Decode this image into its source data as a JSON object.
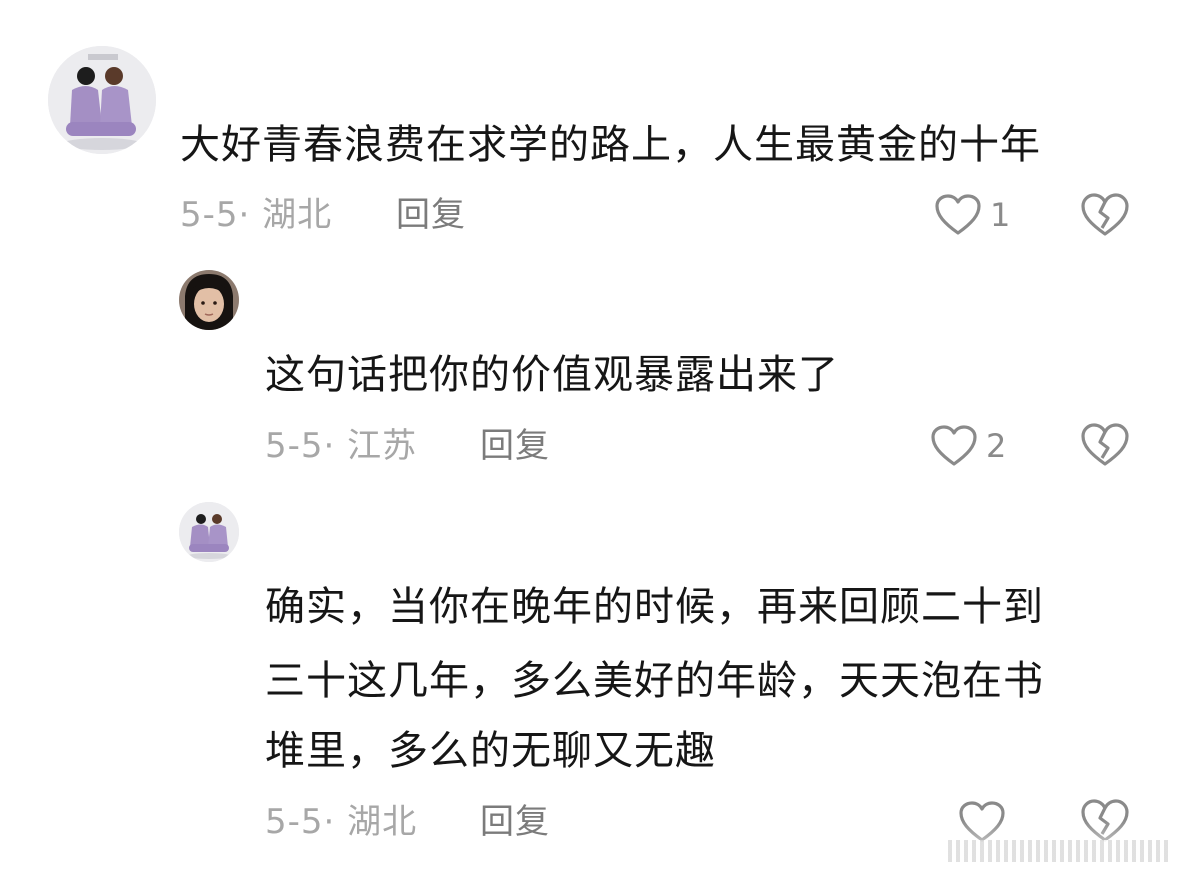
{
  "comments": [
    {
      "text": "大好青春浪费在求学的路上，人生最黄金的十年",
      "date_location": "5-5· 湖北",
      "reply_label": "回复",
      "like_count": "1"
    },
    {
      "text": "这句话把你的价值观暴露出来了",
      "date_location": "5-5· 江苏",
      "reply_label": "回复",
      "like_count": "2"
    },
    {
      "text_lines": [
        "确实，当你在晚年的时候，再来回顾二十到",
        "三十这几年，多么美好的年龄，天天泡在书",
        "堆里，多么的无聊又无趣"
      ],
      "date_location": "5-5· 湖北",
      "reply_label": "回复",
      "like_count": ""
    }
  ],
  "colors": {
    "text": "#161616",
    "meta": "#a7a7a7",
    "reply": "#7b7b7b",
    "icon": "#8a8a8a"
  },
  "icons": {
    "like": "heart-outline-icon",
    "dislike": "broken-heart-icon"
  }
}
